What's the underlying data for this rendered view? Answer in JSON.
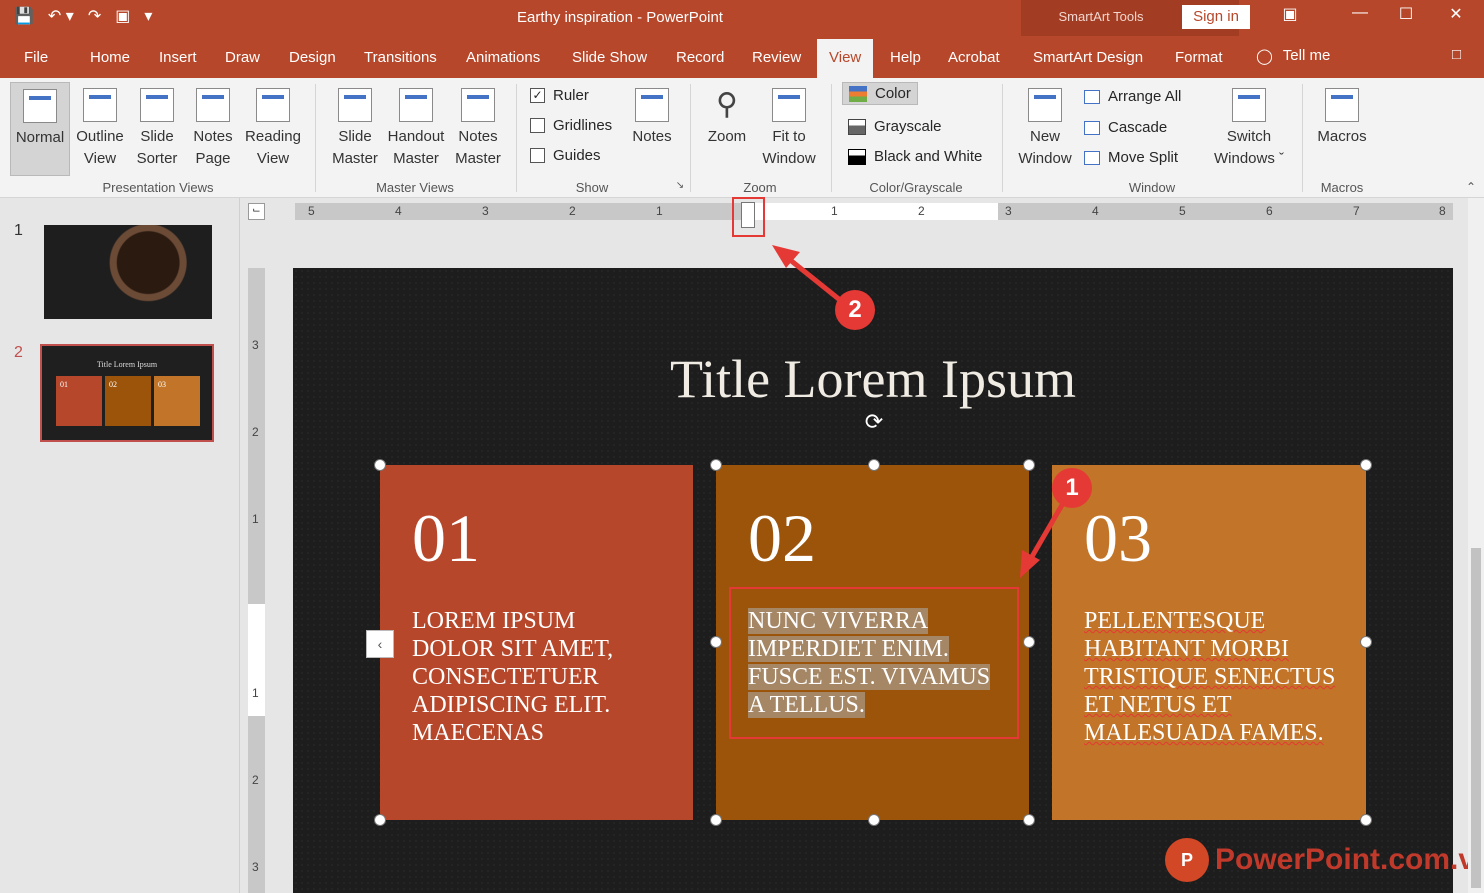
{
  "app": {
    "title": "Earthy inspiration  -  PowerPoint",
    "context_tools": "SmartArt Tools",
    "sign_in": "Sign in"
  },
  "tabs": [
    "File",
    "Home",
    "Insert",
    "Draw",
    "Design",
    "Transitions",
    "Animations",
    "Slide Show",
    "Record",
    "Review",
    "View",
    "Help",
    "Acrobat",
    "SmartArt Design",
    "Format"
  ],
  "active_tab": "View",
  "tell_me": "Tell me",
  "ribbon": {
    "presentation_views": {
      "label": "Presentation Views",
      "buttons": [
        "Normal",
        "Outline View",
        "Slide Sorter",
        "Notes Page",
        "Reading View"
      ]
    },
    "master_views": {
      "label": "Master Views",
      "buttons": [
        "Slide Master",
        "Handout Master",
        "Notes Master"
      ]
    },
    "show": {
      "label": "Show",
      "ruler": "Ruler",
      "gridlines": "Gridlines",
      "guides": "Guides",
      "notes": "Notes",
      "ruler_checked": true
    },
    "zoom": {
      "label": "Zoom",
      "zoom": "Zoom",
      "fit": "Fit to Window"
    },
    "color": {
      "label": "Color/Grayscale",
      "color": "Color",
      "grayscale": "Grayscale",
      "bw": "Black and White"
    },
    "window": {
      "label": "Window",
      "new_window": "New Window",
      "arrange": "Arrange All",
      "cascade": "Cascade",
      "move_split": "Move Split",
      "switch": "Switch Windows"
    },
    "macros": {
      "label": "Macros",
      "macros": "Macros"
    }
  },
  "slides_panel": {
    "numbers": [
      "1",
      "2"
    ],
    "thumb2_title": "Title Lorem Ipsum",
    "thumb2_nums": [
      "01",
      "02",
      "03"
    ]
  },
  "ruler": {
    "h_left": [
      "5",
      "4",
      "3",
      "2",
      "1"
    ],
    "h_right": [
      "1",
      "2",
      "3",
      "4",
      "5",
      "6",
      "7",
      "8"
    ],
    "v": [
      "3",
      "2",
      "1",
      "1",
      "2",
      "3"
    ]
  },
  "slide": {
    "title": "Title Lorem Ipsum",
    "panels": [
      {
        "num": "01",
        "text": "LOREM IPSUM DOLOR SIT AMET, CONSECTETUER ADIPISCING ELIT. MAECENAS",
        "color": "#b7472a"
      },
      {
        "num": "02",
        "text": "NUNC VIVERRA IMPERDIET ENIM. FUSCE EST. VIVAMUS A TELLUS.",
        "color": "#9c540a"
      },
      {
        "num": "03",
        "text": "PELLENTESQUE HABITANT MORBI TRISTIQUE SENECTUS ET NETUS ET MALESUADA FAMES.",
        "color": "#c27428"
      }
    ]
  },
  "callouts": [
    "1",
    "2"
  ],
  "watermark": "PowerPoint.com.vn"
}
